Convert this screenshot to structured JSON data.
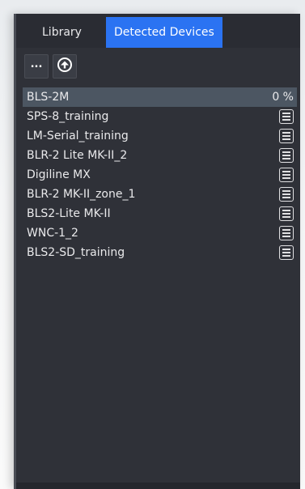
{
  "tabs": {
    "library": "Library",
    "detected": "Detected Devices"
  },
  "toolbar": {
    "more_label": "...",
    "upload_icon": "upload-circle-icon"
  },
  "devices": [
    {
      "name": "BLS-2M",
      "status": "0 %",
      "selected": true
    },
    {
      "name": "SPS-8_training",
      "status": "",
      "selected": false
    },
    {
      "name": "LM-Serial_training",
      "status": "",
      "selected": false
    },
    {
      "name": "BLR-2 Lite MK-II_2",
      "status": "",
      "selected": false
    },
    {
      "name": "Digiline MX",
      "status": "",
      "selected": false
    },
    {
      "name": "BLR-2 MK-II_zone_1",
      "status": "",
      "selected": false
    },
    {
      "name": "BLS2-Lite MK-II",
      "status": "",
      "selected": false
    },
    {
      "name": "WNC-1_2",
      "status": "",
      "selected": false
    },
    {
      "name": "BLS2-SD_training",
      "status": "",
      "selected": false
    }
  ],
  "colors": {
    "panel_bg": "#2f3138",
    "active_tab": "#2b73f2",
    "selected_row": "#4c5662",
    "text": "#e9e9eb"
  },
  "icons": {
    "row_menu": "list-menu-icon"
  }
}
